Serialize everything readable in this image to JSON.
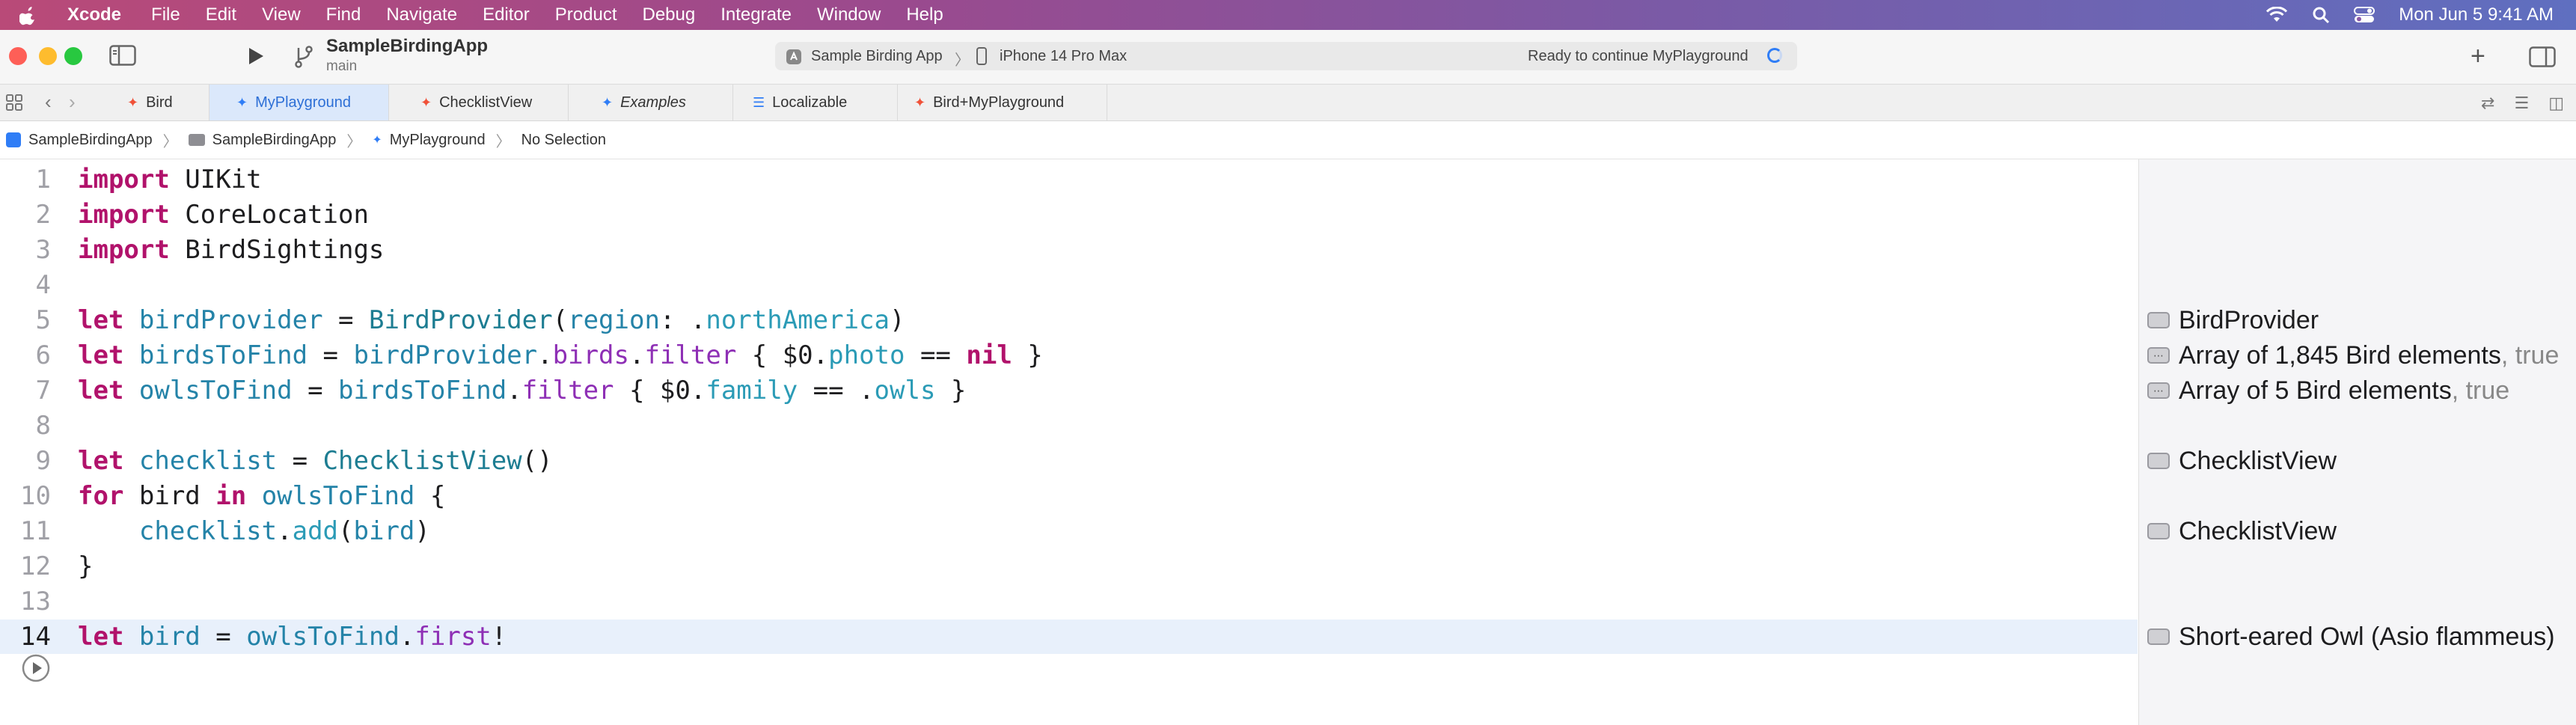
{
  "menubar": {
    "app_name": "Xcode",
    "items": [
      "File",
      "Edit",
      "View",
      "Find",
      "Navigate",
      "Editor",
      "Product",
      "Debug",
      "Integrate",
      "Window",
      "Help"
    ],
    "datetime": "Mon Jun 5  9:41 AM"
  },
  "toolbar": {
    "project_name": "SampleBirdingApp",
    "branch": "main",
    "scheme": "Sample Birding App",
    "scheme_chevron": "〉",
    "device": "iPhone 14 Pro Max",
    "status": "Ready to continue MyPlayground",
    "add_label": "+"
  },
  "tabs": [
    {
      "label": "Bird",
      "icon": "swift-icon"
    },
    {
      "label": "MyPlayground",
      "icon": "playground-icon",
      "active": true
    },
    {
      "label": "ChecklistView",
      "icon": "swift-icon"
    },
    {
      "label": "Examples",
      "icon": "playground-icon",
      "italic": true
    },
    {
      "label": "Localizable",
      "icon": "strings-icon"
    },
    {
      "label": "Bird+MyPlayground",
      "icon": "swift-icon"
    }
  ],
  "jumpbar": {
    "project": "SampleBirdingApp",
    "folder": "SampleBirdingApp",
    "file": "MyPlayground",
    "selection": "No Selection",
    "separator": "〉"
  },
  "editor": {
    "line_numbers": [
      "1",
      "2",
      "3",
      "4",
      "5",
      "6",
      "7",
      "8",
      "9",
      "10",
      "11",
      "12",
      "13",
      "14"
    ],
    "current_line": 14,
    "code": {
      "l1_kw": "import",
      "l1_rest": " UIKit",
      "l2_kw": "import",
      "l2_rest": " CoreLocation",
      "l3_kw": "import",
      "l3_rest": " BirdSightings",
      "l5_kw": "let",
      "l5_var": "birdProvider",
      "l5_eq": " = ",
      "l5_type": "BirdProvider",
      "l5_p1": "(",
      "l5_arg": "region",
      "l5_colon": ": .",
      "l5_prop": "northAmerica",
      "l5_p2": ")",
      "l6_kw": "let",
      "l6_var": "birdsToFind",
      "l6_eq": " = ",
      "l6_obj": "birdProvider",
      "l6_dot1": ".",
      "l6_birds": "birds",
      "l6_dot2": ".",
      "l6_filter": "filter",
      "l6_open": " { $0.",
      "l6_photo": "photo",
      "l6_cmp": " == ",
      "l6_nil": "nil",
      "l6_close": " }",
      "l7_kw": "let",
      "l7_var": "owlsToFind",
      "l7_eq": " = ",
      "l7_obj": "birdsToFind",
      "l7_dot": ".",
      "l7_filter": "filter",
      "l7_open": " { $0.",
      "l7_family": "family",
      "l7_cmp": " == .",
      "l7_owls": "owls",
      "l7_close": " }",
      "l9_kw": "let",
      "l9_var": "checklist",
      "l9_eq": " = ",
      "l9_type": "ChecklistView",
      "l9_parens": "()",
      "l10_kw": "for",
      "l10_bird": " bird ",
      "l10_in": "in",
      "l10_sp": " ",
      "l10_obj": "owlsToFind",
      "l10_brace": " {",
      "l11_indent": "    ",
      "l11_obj": "checklist",
      "l11_dot": ".",
      "l11_add": "add",
      "l11_open": "(",
      "l11_arg": "bird",
      "l11_close": ")",
      "l12_brace": "}",
      "l14_kw": "let",
      "l14_var": "bird",
      "l14_eq": " = ",
      "l14_obj": "owlsToFind",
      "l14_dot": ".",
      "l14_first": "first",
      "l14_bang": "!"
    }
  },
  "results": [
    {
      "line": 5,
      "text": "BirdProvider",
      "icon": "object-icon"
    },
    {
      "line": 6,
      "text": "Array of 1,845 Bird elements",
      "extra": ", true",
      "icon": "array-icon"
    },
    {
      "line": 7,
      "text": "Array of 5 Bird elements",
      "extra": ", true",
      "icon": "array-icon"
    },
    {
      "line": 9,
      "text": "ChecklistView",
      "icon": "object-icon"
    },
    {
      "line": 11,
      "text": "ChecklistView",
      "icon": "object-icon"
    },
    {
      "line": 14,
      "text": "Short-eared Owl (Asio flammeus)",
      "icon": "object-icon"
    }
  ],
  "colors": {
    "keyword": "#b1126b",
    "identifier": "#2483a8",
    "type": "#1d7d92",
    "property": "#2b9bb6",
    "current_line_bg": "#e8f0fb",
    "accent": "#2f7df6"
  }
}
